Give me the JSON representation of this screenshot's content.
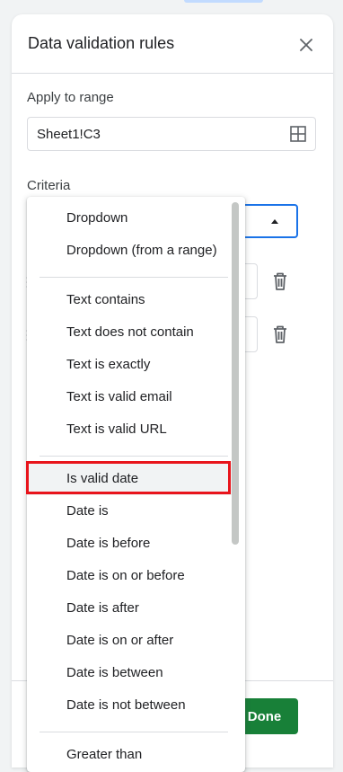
{
  "panel": {
    "title": "Data validation rules",
    "close_icon": "close-icon"
  },
  "apply_to_range": {
    "label": "Apply to range",
    "value": "Sheet1!C3",
    "icon": "grid-select-icon"
  },
  "criteria": {
    "label": "Criteria",
    "arrow_icon": "caret-up-icon"
  },
  "criteria_menu": {
    "groups": [
      [
        "Dropdown",
        "Dropdown (from a range)"
      ],
      [
        "Text contains",
        "Text does not contain",
        "Text is exactly",
        "Text is valid email",
        "Text is valid URL"
      ],
      [
        "Is valid date",
        "Date is",
        "Date is before",
        "Date is on or before",
        "Date is after",
        "Date is on or after",
        "Date is between",
        "Date is not between"
      ],
      [
        "Greater than"
      ]
    ],
    "selected": "Is valid date"
  },
  "footer": {
    "done_label": "Done"
  },
  "colors": {
    "accent_blue": "#1a73e8",
    "done_green": "#188038",
    "highlight_red": "#e8141b"
  }
}
